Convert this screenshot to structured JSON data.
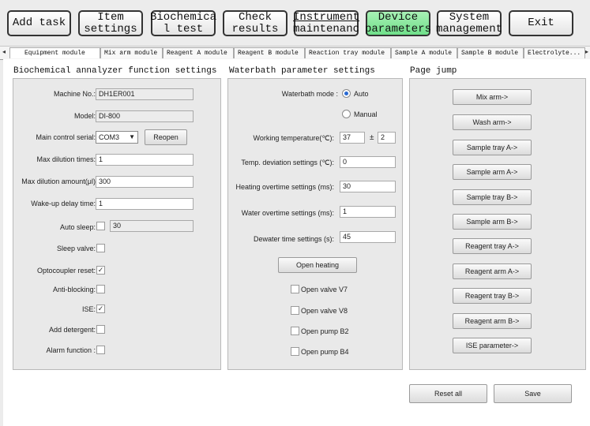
{
  "toolbar": {
    "add_task": "Add task",
    "item_settings": [
      "Item",
      "settings"
    ],
    "biochemical_test": [
      "Biochemica",
      "l test"
    ],
    "check_results": [
      "Check",
      "results"
    ],
    "instrument_maintenance": [
      "Instrument",
      "maintenanc"
    ],
    "device_parameters": [
      "Device",
      "parameters"
    ],
    "system_management": [
      "System",
      "management"
    ],
    "exit": "Exit"
  },
  "tabs": [
    "Equipment module",
    "Mix arm module",
    "Reagent A module",
    "Reagent B module",
    "Reaction tray module",
    "Sample A module",
    "Sample B module",
    "Electrolyte..."
  ],
  "sections": {
    "biochem_title": "Biochemical annalyzer function settings",
    "waterbath_title": "Waterbath parameter settings",
    "pagejump_title": "Page jump"
  },
  "biochem": {
    "machine_no_label": "Machine No.:",
    "machine_no_value": "DH1ER001",
    "model_label": "Model:",
    "model_value": "DI-800",
    "serial_label": "Main control serial:",
    "serial_value": "COM3",
    "reopen_label": "Reopen",
    "max_dilution_times_label": "Max dilution times:",
    "max_dilution_times_value": "1",
    "max_dilution_amount_label": "Max dilution amount(μl)",
    "max_dilution_amount_value": "300",
    "wakeup_delay_label": "Wake-up delay time:",
    "wakeup_delay_value": "1",
    "auto_sleep_label": "Auto sleep:",
    "auto_sleep_value": "30",
    "sleep_valve_label": "Sleep valve:",
    "optocoupler_label": "Optocoupler reset:",
    "anti_blocking_label": "Anti-blocking:",
    "ise_label": "ISE:",
    "add_detergent_label": "Add detergent:",
    "alarm_label": "Alarm function :",
    "auto_sleep_checked": false,
    "sleep_valve_checked": false,
    "optocoupler_checked": true,
    "anti_blocking_checked": false,
    "ise_checked": true,
    "add_detergent_checked": false,
    "alarm_checked": false
  },
  "waterbath": {
    "mode_label": "Waterbath mode :",
    "mode_auto": "Auto",
    "mode_manual": "Manual",
    "mode_selected": "Auto",
    "working_temp_label": "Working temperature(℃):",
    "working_temp_value": "37",
    "plus_minus": "±",
    "working_temp_tol": "2",
    "temp_dev_label": "Temp. deviation settings (℃):",
    "temp_dev_value": "0",
    "heating_overtime_label": "Heating overtime settings (ms):",
    "heating_overtime_value": "30",
    "water_overtime_label": "Water overtime settings (ms):",
    "water_overtime_value": "1",
    "dewater_label": "Dewater time settings (s):",
    "dewater_value": "45",
    "open_heating": "Open heating",
    "valve_v7": "Open valve V7",
    "valve_v8": "Open valve V8",
    "pump_b2": "Open pump B2",
    "pump_b4": "Open pump B4"
  },
  "pagejump": [
    "Mix arm->",
    "Wash arm->",
    "Sample tray A->",
    "Sample arm A->",
    "Sample tray B->",
    "Sample arm B->",
    "Reagent tray A->",
    "Reagent arm A->",
    "Reagent tray B->",
    "Reagent arm B->",
    "ISE parameter->"
  ],
  "footer": {
    "reset_all": "Reset all",
    "save": "Save"
  },
  "colors": {
    "active_toolbar": "#6fe08a",
    "panel_bg": "#e9e9e9",
    "radio_dot": "#2a6ad2"
  }
}
